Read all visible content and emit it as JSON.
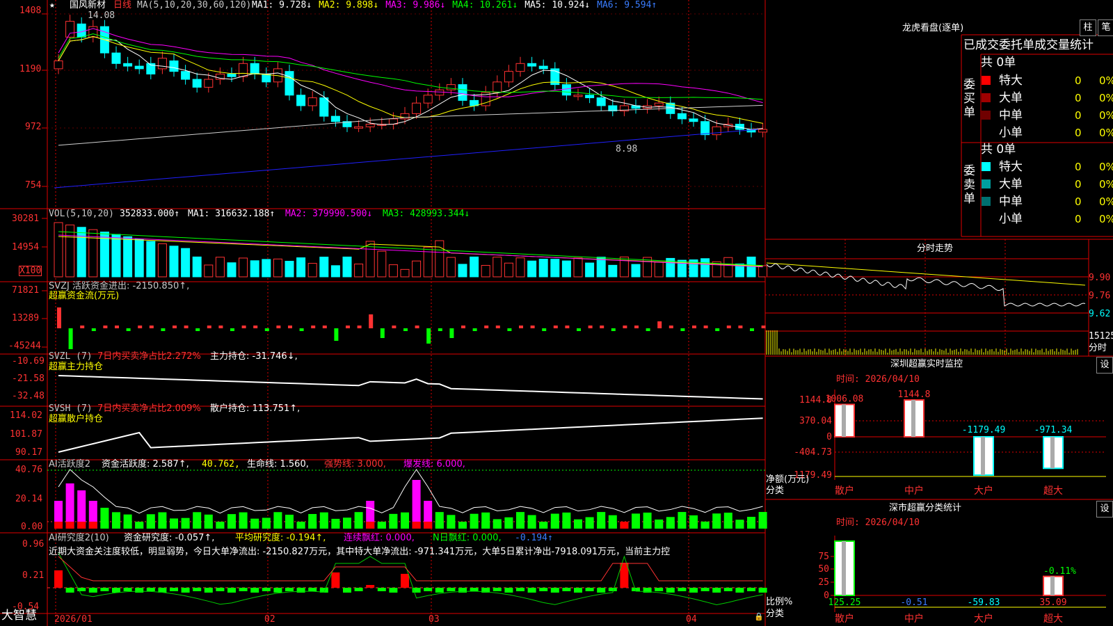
{
  "header": {
    "star": "★",
    "name": "国风新材",
    "period": "日线",
    "ma_label": "MA(5,10,20,30,60,120)",
    "mas": [
      {
        "text": "MA1: 9.728↓",
        "color": "#ffffff"
      },
      {
        "text": "MA2: 9.898↓",
        "color": "#ffff00"
      },
      {
        "text": "MA3: 9.986↓",
        "color": "#ff00ff"
      },
      {
        "text": "MA4: 10.261↓",
        "color": "#00ff00"
      },
      {
        "text": "MA5: 10.924↓",
        "color": "#ffffff"
      },
      {
        "text": "MA6: 9.594↑",
        "color": "#3a7dff"
      }
    ]
  },
  "main_chart": {
    "y_labels": [
      "1408",
      "1190",
      "972",
      "754"
    ],
    "high_label": "14.08",
    "low_label": "8.98"
  },
  "vol_panel": {
    "title": "VOL(5,10,20)",
    "value": "352833.000↑",
    "ma1": "MA1: 316632.188↑",
    "ma2": "MA2: 379990.500↓",
    "ma3": "MA3: 428993.344↓",
    "y_labels": [
      "30281",
      "14954",
      "X100"
    ]
  },
  "svzj_panel": {
    "title": "SVZJ  活跃资金进出: -2150.850↑,",
    "subtitle": "超赢资金流(万元)",
    "y_labels": [
      "71821",
      "13289",
      "-45244"
    ]
  },
  "svzl_panel": {
    "title": "SVZL (7)",
    "ratio": "7日内买卖净占比2.272%",
    "holding": "主力持仓: -31.746↓,",
    "subtitle": "超赢主力持仓",
    "y_labels": [
      "-10.69",
      "-21.58",
      "-32.48"
    ]
  },
  "svsh_panel": {
    "title": "SVSH (7)",
    "ratio": "7日内买卖净占比2.009%",
    "holding": "散户持仓: 113.751↑,",
    "subtitle": "超赢散户持仓",
    "y_labels": [
      "114.02",
      "101.87",
      "90.17"
    ]
  },
  "ai_active_panel": {
    "title": "AI活跃度2",
    "fund": "资金活跃度: 2.587↑,",
    "val2": "40.762,",
    "life": "生命线: 1.560,",
    "strong": "强势线: 3.000,",
    "burst": "爆发线: 6.000,",
    "y_labels": [
      "40.76",
      "20.14",
      "0.00"
    ]
  },
  "ai_research_panel": {
    "title": "AI研究度2(10)",
    "fund": "资金研究度: -0.057↑,",
    "avg": "平均研究度: -0.194↑,",
    "streak": "连续飘红: 0.000,",
    "nday": "N日飘红: 0.000,",
    "last": "-0.194↑",
    "comment": "近期大资金关注度较低，明显弱势，今日大单净流出: -2150.827万元，其中特大单净流出: -971.341万元，大单5日累计净出-7918.091万元，当前主力控",
    "y_labels": [
      "0.96",
      "0.21",
      "-0.54"
    ]
  },
  "x_axis": {
    "labels": [
      "2026/01",
      "02",
      "03",
      "04"
    ]
  },
  "brand": "大智慧",
  "dragon_tiger": {
    "title": "龙虎看盘(逐单)",
    "btn1": "柱",
    "btn2": "笔",
    "subtitle": "已成交委托单成交量统计",
    "buy_label": "委买单",
    "sell_label": "委卖单",
    "buy_total": "共 0单",
    "sell_total": "共 0单",
    "buy_rows": [
      {
        "label": "特大",
        "count": "0",
        "pct": "0%",
        "color": "#ff0000"
      },
      {
        "label": "大单",
        "count": "0",
        "pct": "0%",
        "color": "#a00000"
      },
      {
        "label": "中单",
        "count": "0",
        "pct": "0%",
        "color": "#700000"
      },
      {
        "label": "小单",
        "count": "0",
        "pct": "0%",
        "color": "#000000"
      }
    ],
    "sell_rows": [
      {
        "label": "特大",
        "count": "0",
        "pct": "0%",
        "color": "#00ffff"
      },
      {
        "label": "大单",
        "count": "0",
        "pct": "0%",
        "color": "#00a0a0"
      },
      {
        "label": "中单",
        "count": "0",
        "pct": "0%",
        "color": "#007070"
      },
      {
        "label": "小单",
        "count": "0",
        "pct": "0%",
        "color": "#000000"
      }
    ]
  },
  "intraday": {
    "title": "分时走势",
    "y_labels": [
      "9.90",
      "9.76",
      "9.62"
    ],
    "vol_label": "15125",
    "vol_unit": "分时"
  },
  "sz_monitor": {
    "title": "深圳超赢实时监控",
    "btn": "设",
    "time": "时间: 2026/04/10",
    "y_labels": [
      "1144.8",
      "370.04",
      "0",
      "-404.73",
      "-1179.49"
    ],
    "y_unit1": "净额(万元)",
    "y_unit2": "分类",
    "categories": [
      "散户",
      "中户",
      "大户",
      "超大"
    ],
    "values": [
      1006.08,
      1144.8,
      -1179.49,
      -971.34
    ],
    "value_labels": [
      "1006.08",
      "1144.8",
      "-1179.49",
      "-971.34"
    ]
  },
  "sz_stats": {
    "title": "深市超赢分类统计",
    "btn": "设",
    "time": "时间: 2026/04/10",
    "y_labels": [
      "75",
      "50",
      "25",
      "0"
    ],
    "y_unit1": "比例%",
    "y_unit2": "分类",
    "categories": [
      "散户",
      "中户",
      "大户",
      "超大"
    ],
    "values": [
      125.25,
      -0.51,
      -59.83,
      35.09
    ],
    "value_labels": [
      "125.25",
      "-0.51",
      "-59.83",
      "35.09"
    ],
    "extra_label": "-0.11%"
  },
  "chart_data": {
    "type": "bar",
    "title": "深圳超赢实时监控",
    "categories": [
      "散户",
      "中户",
      "大户",
      "超大"
    ],
    "values": [
      1006.08,
      1144.8,
      -1179.49,
      -971.34
    ],
    "ylabel": "净额(万元)",
    "xlabel": "分类",
    "ylim": [
      -1179.49,
      1144.8
    ]
  }
}
